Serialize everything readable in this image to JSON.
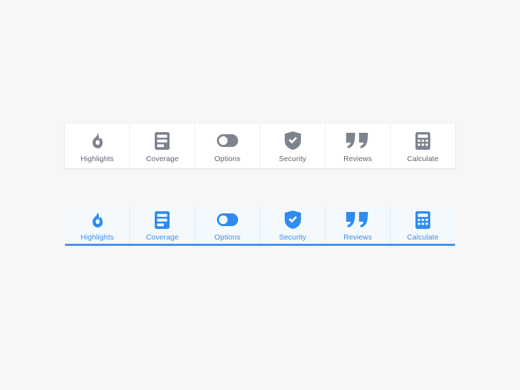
{
  "page": {
    "background_color": "#f7f7f8",
    "inactive_icon_color": "#7d838f",
    "inactive_label_color": "#5b6270",
    "active_icon_color": "#2f8bf0",
    "active_label_color": "#3b8bea",
    "active_bar_background": "#f4f9fe",
    "active_underline_color": "#4a90e2",
    "card_background": "#ffffff"
  },
  "tabbars": [
    {
      "name": "default-state",
      "state": "default",
      "tabs": [
        {
          "label": "Highlights",
          "icon": "flame-icon"
        },
        {
          "label": "Coverage",
          "icon": "document-lines-icon"
        },
        {
          "label": "Options",
          "icon": "toggle-switch-icon"
        },
        {
          "label": "Security",
          "icon": "shield-check-icon"
        },
        {
          "label": "Reviews",
          "icon": "quote-marks-icon"
        },
        {
          "label": "Calculate",
          "icon": "calculator-icon"
        }
      ]
    },
    {
      "name": "selected-state",
      "state": "selected",
      "tabs": [
        {
          "label": "Highlights",
          "icon": "flame-icon"
        },
        {
          "label": "Coverage",
          "icon": "document-lines-icon"
        },
        {
          "label": "Options",
          "icon": "toggle-switch-icon"
        },
        {
          "label": "Security",
          "icon": "shield-check-icon"
        },
        {
          "label": "Reviews",
          "icon": "quote-marks-icon"
        },
        {
          "label": "Calculate",
          "icon": "calculator-icon"
        }
      ]
    }
  ]
}
